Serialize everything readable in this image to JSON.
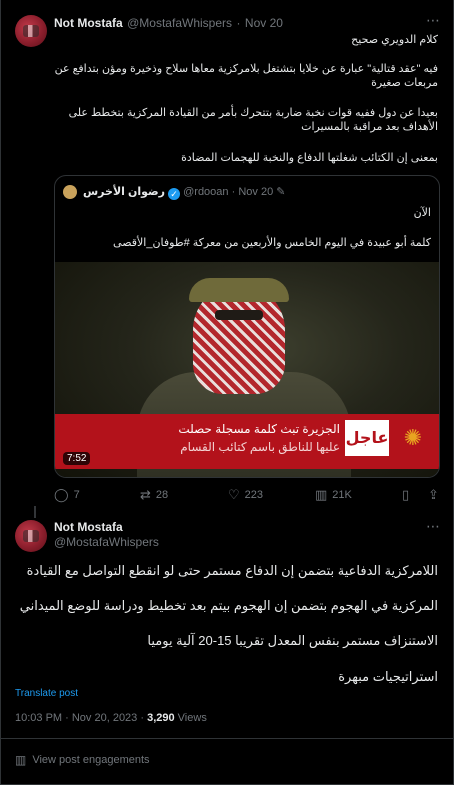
{
  "post1": {
    "name": "Not Mostafa",
    "handle": "@MostafaWhispers",
    "dot": "·",
    "date": "Nov 20",
    "more": "⋯",
    "lines": [
      "كلام الدويري صحيح",
      "فيه \"عقد قتالية\" عبارة عن خلايا بتشتغل بلامركزية معاها سلاح وذخيرة ومؤن بتدافع عن مربعات صغيرة",
      "بعيدا عن دول ففيه قوات نخبة ضاربة بتتحرك بأمر من القيادة المركزية بتخطط على الأهداف بعد مراقبة بالمسيرات",
      "بمعنى إن الكتائب شغلتها الدفاع والنخبة للهجمات المضادة"
    ]
  },
  "quote": {
    "name": "رضوان الأخرس",
    "handle": "@rdooan",
    "dot": "·",
    "date": "Nov 20",
    "lines": [
      "الآن",
      "كلمة أبو عبيدة في اليوم الخامس والأربعين من معركة #طوفان_الأقصى"
    ],
    "video": {
      "tag": "عاجل",
      "banner_line1": "الجزيرة تبث كلمة مسجلة حصلت",
      "banner_line2": "عليها للناطق باسم كتائب القسام",
      "duration": "7:52"
    }
  },
  "actions": {
    "replies": "7",
    "reposts": "28",
    "likes": "223",
    "views": "21K"
  },
  "post2": {
    "name": "Not Mostafa",
    "handle": "@MostafaWhispers",
    "lines": [
      "اللامركزية الدفاعية بتضمن إن الدفاع مستمر حتى لو انقطع التواصل مع القيادة",
      "المركزية في الهجوم بتضمن إن الهجوم بيتم بعد تخطيط ودراسة للوضع الميداني",
      "الاستنزاف مستمر بنفس المعدل تقريبا 15-20 آلية يوميا",
      "استراتيجيات مبهرة"
    ],
    "translate": "Translate post",
    "time": "10:03 PM · Nov 20, 2023 ·",
    "views_count": "3,290",
    "views_label": "Views",
    "engagements": "View post engagements"
  },
  "colors": {
    "background": "#000000",
    "text": "#e7e9ea",
    "muted": "#71767b",
    "link": "#1d9bf0",
    "border": "#2f3336",
    "verified": "#1d9bf0",
    "breaking": "#b3121b"
  },
  "icons": [
    "reply-icon",
    "repost-icon",
    "like-icon",
    "views-icon",
    "bookmark-icon",
    "share-icon",
    "verified-icon",
    "more-icon",
    "engagements-icon"
  ]
}
